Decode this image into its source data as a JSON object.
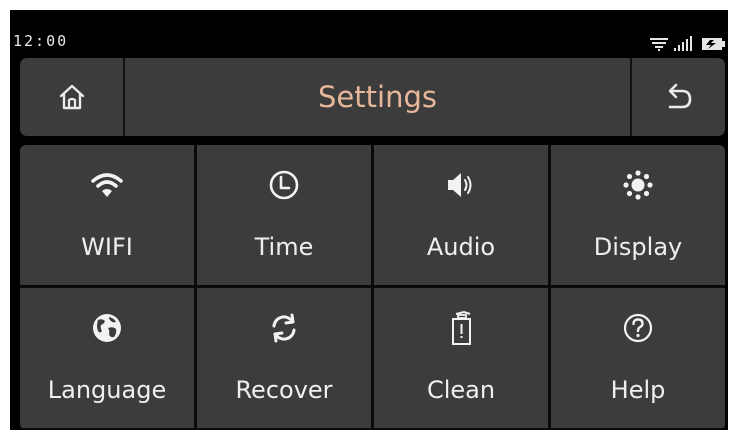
{
  "statusbar": {
    "time": "12:00",
    "icons": [
      "wifi-icon",
      "signal-icon",
      "battery-charging-icon"
    ]
  },
  "header": {
    "title": "Settings",
    "home_icon": "home-icon",
    "back_icon": "back-arrow-icon"
  },
  "tiles": [
    {
      "label": "WIFI",
      "icon": "wifi-icon"
    },
    {
      "label": "Time",
      "icon": "clock-icon"
    },
    {
      "label": "Audio",
      "icon": "speaker-icon"
    },
    {
      "label": "Display",
      "icon": "brightness-icon"
    },
    {
      "label": "Language",
      "icon": "globe-icon"
    },
    {
      "label": "Recover",
      "icon": "refresh-icon"
    },
    {
      "label": "Clean",
      "icon": "trash-icon"
    },
    {
      "label": "Help",
      "icon": "help-icon"
    }
  ],
  "colors": {
    "title": "#e6b79a",
    "panel": "#3c3c3c",
    "background": "#000000",
    "text": "#efefef"
  }
}
